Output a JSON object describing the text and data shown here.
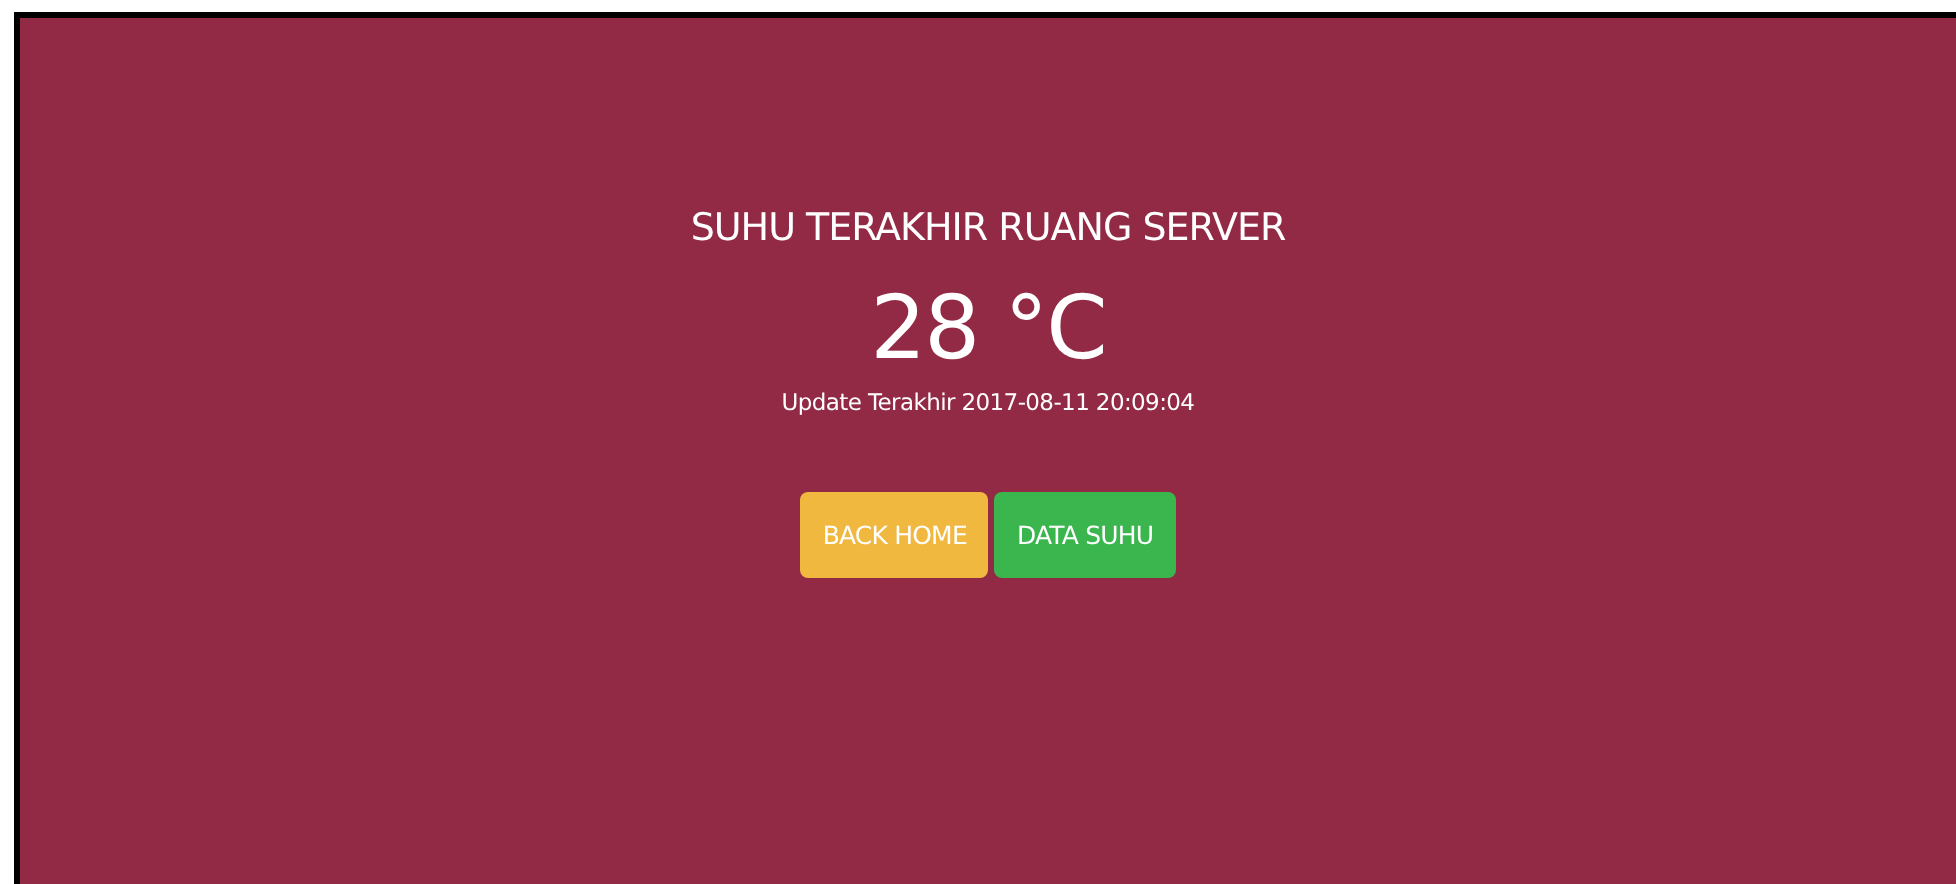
{
  "title": "SUHU TERAKHIR RUANG SERVER",
  "temperature": "28 °C",
  "update": "Update Terakhir 2017-08-11 20:09:04",
  "buttons": [
    {
      "label": "BACK HOME",
      "kind": "warning"
    },
    {
      "label": "DATA SUHU",
      "kind": "success"
    }
  ]
}
